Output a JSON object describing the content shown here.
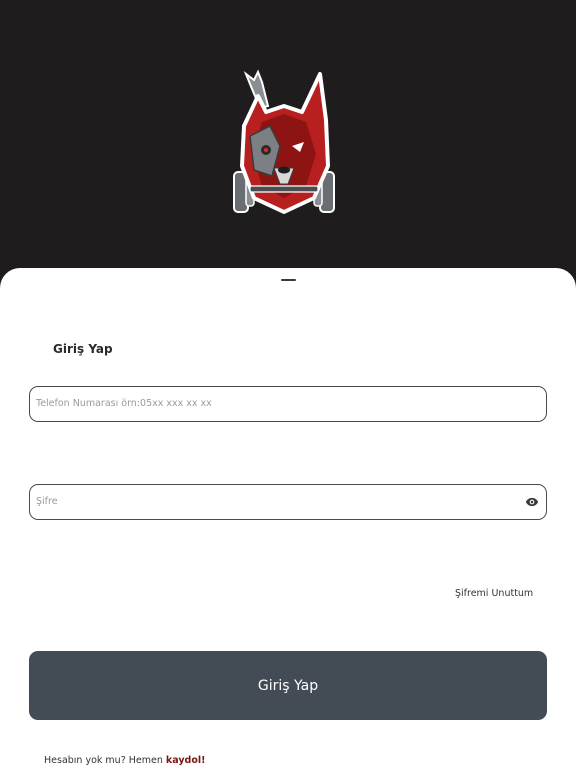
{
  "login": {
    "title": "Giriş Yap",
    "phone_placeholder": "Telefon Numarası örn:05xx xxx xx xx",
    "phone_value": "",
    "password_placeholder": "Şifre",
    "password_value": "",
    "forgot_password": "Şifremi Unuttum",
    "submit_label": "Giriş Yap",
    "signup_prompt": "Hesabın yok mu? Hemen",
    "signup_link": "kaydol!"
  },
  "icons": {
    "logo": "wolf-dumbbell-logo-icon",
    "toggle_visibility": "eye-icon"
  },
  "colors": {
    "header_background": "#1e1c1d",
    "sheet_background": "#ffffff",
    "button_background": "#434b55",
    "signup_link": "#7a1515",
    "logo_red": "#b82020"
  }
}
